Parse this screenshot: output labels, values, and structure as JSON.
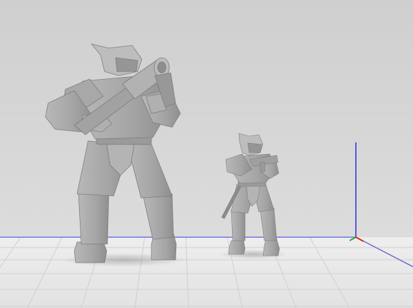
{
  "scene": {
    "background_color": "#d9d9d9",
    "floor_color": "#e6e6e6",
    "grid_line_color": "#cfcfcf",
    "model_color": "#a9a9a9",
    "model_shadow_color": "#8a8a8a",
    "subjects": [
      {
        "name": "large-armored-trooper-with-launcher"
      },
      {
        "name": "small-armored-trooper-with-pistol"
      }
    ],
    "axis_gizmo": {
      "x_axis_color": "#e02020",
      "y_axis_color": "#20b020",
      "z_axis_color": "#2a2ad8",
      "floor_edge_color": "#7070e8"
    }
  }
}
